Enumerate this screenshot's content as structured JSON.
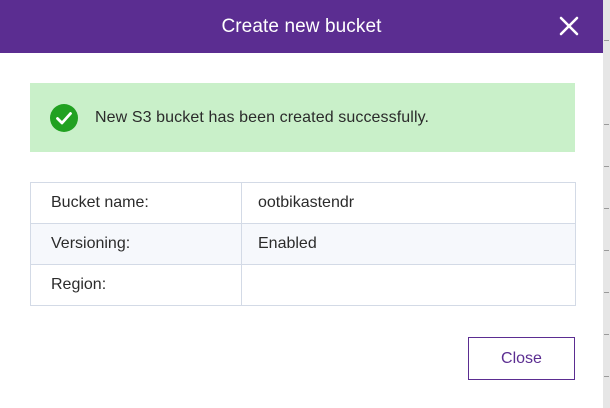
{
  "dialog": {
    "title": "Create new bucket",
    "close_icon": "close-icon",
    "header_color": "#5b2d91"
  },
  "alert": {
    "icon": "check-circle-icon",
    "message": "New S3 bucket has been created successfully.",
    "background": "#c9f0c9",
    "icon_color": "#21a121"
  },
  "details": {
    "rows": [
      {
        "label": "Bucket name:",
        "value": "ootbikastendr"
      },
      {
        "label": "Versioning:",
        "value": "Enabled"
      },
      {
        "label": "Region:",
        "value": ""
      }
    ]
  },
  "footer": {
    "close_label": "Close"
  }
}
